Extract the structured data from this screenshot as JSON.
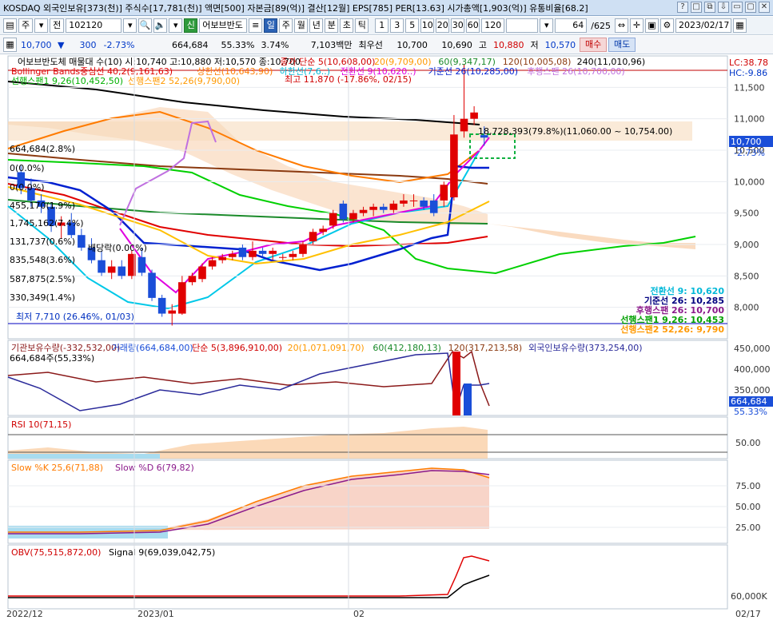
{
  "titlebar": {
    "text": "KOSDAQ 외국인보유[373(천)] 주식수[17,781(천)] 액면[500] 자본금[89(억)] 결산[12월] EPS[785] PER[13.63] 시가총액[1,903(억)] 유통비율[68.2]",
    "buttons": [
      "?",
      "□",
      "⧉",
      "⇩",
      "▭",
      "▢",
      "✕"
    ]
  },
  "toolbar1": {
    "period_select": "주",
    "total_button": "전",
    "code": "102120",
    "search_icon": "search-icon",
    "sound_icon": "speaker-icon",
    "credit_badge": "신",
    "stock_name": "어보브반도",
    "period_tabs": [
      "일",
      "주",
      "월",
      "년",
      "분",
      "초",
      "틱"
    ],
    "active_tab": "일",
    "interval_buttons": [
      "1",
      "3",
      "5",
      "10",
      "20",
      "30",
      "60",
      "120"
    ],
    "count": "64",
    "count_total": "/625",
    "date": "2023/02/17"
  },
  "toolbar2": {
    "price": "10,700",
    "change_arrow": "▼",
    "change": "300",
    "change_pct": "-2.73%",
    "volume": "664,684",
    "volume_pct": "55.33%",
    "turnover_pct": "3.74%",
    "amount": "7,103백만",
    "priority_label": "최우선",
    "ask": "10,700",
    "bid": "10,690",
    "high_label": "고",
    "high": "10,880",
    "low_label": "저",
    "low": "10,570",
    "buy_label": "매수",
    "sell_label": "매도"
  },
  "chart_data": [
    {
      "type": "candlestick",
      "panel": "price",
      "legend_line1": [
        "어보브반도체 매물대 수(10) 시:10,740 고:10,880 저:10,570 종:10,700",
        "종가 단순 5(10,608,00)",
        "20(9,709,00)",
        "60(9,347,17)",
        "120(10,005,08)",
        "240(11,010,96)"
      ],
      "legend_line2": [
        "Bollinger Bands중심선 40,2(9,161,63)",
        "상한선(10,643,90)",
        "하한선(7,6..)",
        "전환선 9(10,620..)",
        "기준선 26(10,285,00)",
        "후행스팬 26(10,700,00)"
      ],
      "legend_line3": [
        "선행스팬1 9,26(10,452,50)",
        "선행스팬2 52,26(9,790,00)"
      ],
      "corner_labels": [
        "LC:38.78",
        "HC:-9.86"
      ],
      "ylim": [
        7500,
        12000
      ],
      "yticks": [
        8000,
        8500,
        9000,
        9500,
        10000,
        10500,
        11000,
        11500
      ],
      "ytick_labels": [
        "8,000",
        "8,500",
        "9,000",
        "9,500",
        "10,000",
        "10,500",
        "11,000",
        "11,500"
      ],
      "current_price_label": "10,700",
      "current_change_label": "-2.73%",
      "high_annotation": "최고 11,870 (-17.86%, 02/15)",
      "low_annotation": "최저 7,710 (26.46%, 01/03)",
      "peak_annotation": "18,728,393(79.8%)(11,060.00 ~ 10,754.00)",
      "dividend_label": "배당락(0.00%)",
      "volume_profile_labels": [
        "664,684(2.8%)",
        "0(0.0%)",
        "0(0.0%)",
        "455,170(1.9%)",
        "1,745,162(7.4%)",
        "131,737(0.6%)",
        "835,548(3.6%)",
        "587,875(2.5%)",
        "330,349(1.4%)"
      ],
      "ichimoku_labels": [
        "전환선 9: 10,620",
        "기준선 26: 10,285",
        "후행스팬 26: 10,700",
        "선행스팬1 9,26: 10,453",
        "선행스팬2 52,26: 9,790"
      ],
      "candles": [
        {
          "date": "2022-12-12",
          "o": 10150,
          "h": 10250,
          "l": 9800,
          "c": 9900
        },
        {
          "date": "2022-12-13",
          "o": 9900,
          "h": 10050,
          "l": 9600,
          "c": 9700
        },
        {
          "date": "2022-12-14",
          "o": 9700,
          "h": 9800,
          "l": 9500,
          "c": 9600
        },
        {
          "date": "2022-12-15",
          "o": 9600,
          "h": 9650,
          "l": 9200,
          "c": 9300
        },
        {
          "date": "2022-12-16",
          "o": 9300,
          "h": 9450,
          "l": 9100,
          "c": 9350
        },
        {
          "date": "2022-12-19",
          "o": 9350,
          "h": 9500,
          "l": 9100,
          "c": 9150
        },
        {
          "date": "2022-12-20",
          "o": 9150,
          "h": 9250,
          "l": 8900,
          "c": 8950
        },
        {
          "date": "2022-12-21",
          "o": 8950,
          "h": 9100,
          "l": 8700,
          "c": 8750
        },
        {
          "date": "2022-12-22",
          "o": 8750,
          "h": 8900,
          "l": 8500,
          "c": 8550
        },
        {
          "date": "2022-12-23",
          "o": 8550,
          "h": 8750,
          "l": 8450,
          "c": 8650
        },
        {
          "date": "2022-12-26",
          "o": 8650,
          "h": 8750,
          "l": 8450,
          "c": 8500
        },
        {
          "date": "2022-12-27",
          "o": 8500,
          "h": 8900,
          "l": 8450,
          "c": 8850
        },
        {
          "date": "2022-12-28",
          "o": 8800,
          "h": 8950,
          "l": 8500,
          "c": 8550
        },
        {
          "date": "2022-12-29",
          "o": 8550,
          "h": 8600,
          "l": 8100,
          "c": 8150
        },
        {
          "date": "2023-01-02",
          "o": 8150,
          "h": 8200,
          "l": 7850,
          "c": 7900
        },
        {
          "date": "2023-01-03",
          "o": 7900,
          "h": 8050,
          "l": 7710,
          "c": 7950
        },
        {
          "date": "2023-01-04",
          "o": 7900,
          "h": 8500,
          "l": 7880,
          "c": 8400
        },
        {
          "date": "2023-01-05",
          "o": 8400,
          "h": 8550,
          "l": 8350,
          "c": 8500
        },
        {
          "date": "2023-01-06",
          "o": 8450,
          "h": 8700,
          "l": 8400,
          "c": 8650
        },
        {
          "date": "2023-01-09",
          "o": 8650,
          "h": 8800,
          "l": 8600,
          "c": 8750
        },
        {
          "date": "2023-01-10",
          "o": 8750,
          "h": 8850,
          "l": 8700,
          "c": 8800
        },
        {
          "date": "2023-01-11",
          "o": 8800,
          "h": 8900,
          "l": 8750,
          "c": 8850
        },
        {
          "date": "2023-01-12",
          "o": 8950,
          "h": 9000,
          "l": 8750,
          "c": 8800
        },
        {
          "date": "2023-01-13",
          "o": 8800,
          "h": 9050,
          "l": 8750,
          "c": 8900
        },
        {
          "date": "2023-01-16",
          "o": 8900,
          "h": 8950,
          "l": 8800,
          "c": 8850
        },
        {
          "date": "2023-01-17",
          "o": 8850,
          "h": 8950,
          "l": 8750,
          "c": 8900
        },
        {
          "date": "2023-01-18",
          "o": 8800,
          "h": 8850,
          "l": 8750,
          "c": 8800
        },
        {
          "date": "2023-01-19",
          "o": 8800,
          "h": 8900,
          "l": 8750,
          "c": 8850
        },
        {
          "date": "2023-01-20",
          "o": 8850,
          "h": 9050,
          "l": 8800,
          "c": 9000
        },
        {
          "date": "2023-01-25",
          "o": 9050,
          "h": 9250,
          "l": 9000,
          "c": 9200
        },
        {
          "date": "2023-01-26",
          "o": 9200,
          "h": 9300,
          "l": 9150,
          "c": 9250
        },
        {
          "date": "2023-01-27",
          "o": 9300,
          "h": 9550,
          "l": 9250,
          "c": 9500
        },
        {
          "date": "2023-01-30",
          "o": 9650,
          "h": 9700,
          "l": 9350,
          "c": 9400
        },
        {
          "date": "2023-01-31",
          "o": 9400,
          "h": 9550,
          "l": 9350,
          "c": 9500
        },
        {
          "date": "2023-02-01",
          "o": 9500,
          "h": 9600,
          "l": 9450,
          "c": 9550
        },
        {
          "date": "2023-02-02",
          "o": 9550,
          "h": 9650,
          "l": 9450,
          "c": 9600
        },
        {
          "date": "2023-02-03",
          "o": 9600,
          "h": 9650,
          "l": 9500,
          "c": 9550
        },
        {
          "date": "2023-02-06",
          "o": 9550,
          "h": 9700,
          "l": 9500,
          "c": 9650
        },
        {
          "date": "2023-02-07",
          "o": 9650,
          "h": 9800,
          "l": 9600,
          "c": 9700
        },
        {
          "date": "2023-02-08",
          "o": 9700,
          "h": 9800,
          "l": 9600,
          "c": 9700
        },
        {
          "date": "2023-02-09",
          "o": 9700,
          "h": 9750,
          "l": 9550,
          "c": 9600
        },
        {
          "date": "2023-02-10",
          "o": 9700,
          "h": 9800,
          "l": 9450,
          "c": 9500
        },
        {
          "date": "2023-02-13",
          "o": 9700,
          "h": 10000,
          "l": 9600,
          "c": 9950
        },
        {
          "date": "2023-02-14",
          "o": 9750,
          "h": 11060,
          "l": 9700,
          "c": 10750
        },
        {
          "date": "2023-02-15",
          "o": 10800,
          "h": 11870,
          "l": 10700,
          "c": 11000
        },
        {
          "date": "2023-02-16",
          "o": 11000,
          "h": 11200,
          "l": 10900,
          "c": 11100
        },
        {
          "date": "2023-02-17",
          "o": 10740,
          "h": 10880,
          "l": 10570,
          "c": 10700
        }
      ]
    },
    {
      "type": "bar",
      "panel": "volume",
      "legend": [
        "기관보유수량(-332,532,00)",
        "거래량(664,684,00)",
        "단순 5(3,896,910,00)",
        "20(1,071,091,70)",
        "60(412,180,13)",
        "120(317,213,58)",
        "외국인보유수량(373,254,00)"
      ],
      "sub_label": "664,684주(55,33%)",
      "yticks": [
        "450,000",
        "400,000",
        "350,000"
      ],
      "current_labels": [
        "664,684",
        "55.33%"
      ]
    },
    {
      "type": "area",
      "panel": "rsi",
      "legend": [
        "RSI 10(71,15)"
      ],
      "yticks": [
        "50.00"
      ]
    },
    {
      "type": "line",
      "panel": "stochastic",
      "legend": [
        "Slow %K 25,6(71,88)",
        "Slow %D 6(79,82)"
      ],
      "yticks": [
        "75.00",
        "50.00",
        "25.00"
      ]
    },
    {
      "type": "line",
      "panel": "obv",
      "legend": [
        "OBV(75,515,872,00)",
        "Signal 9(69,039,042,75)"
      ],
      "yticks": [
        "60,000K"
      ]
    }
  ],
  "x_axis_labels": [
    "2022/12",
    "2023/01",
    "02",
    "02/17"
  ]
}
